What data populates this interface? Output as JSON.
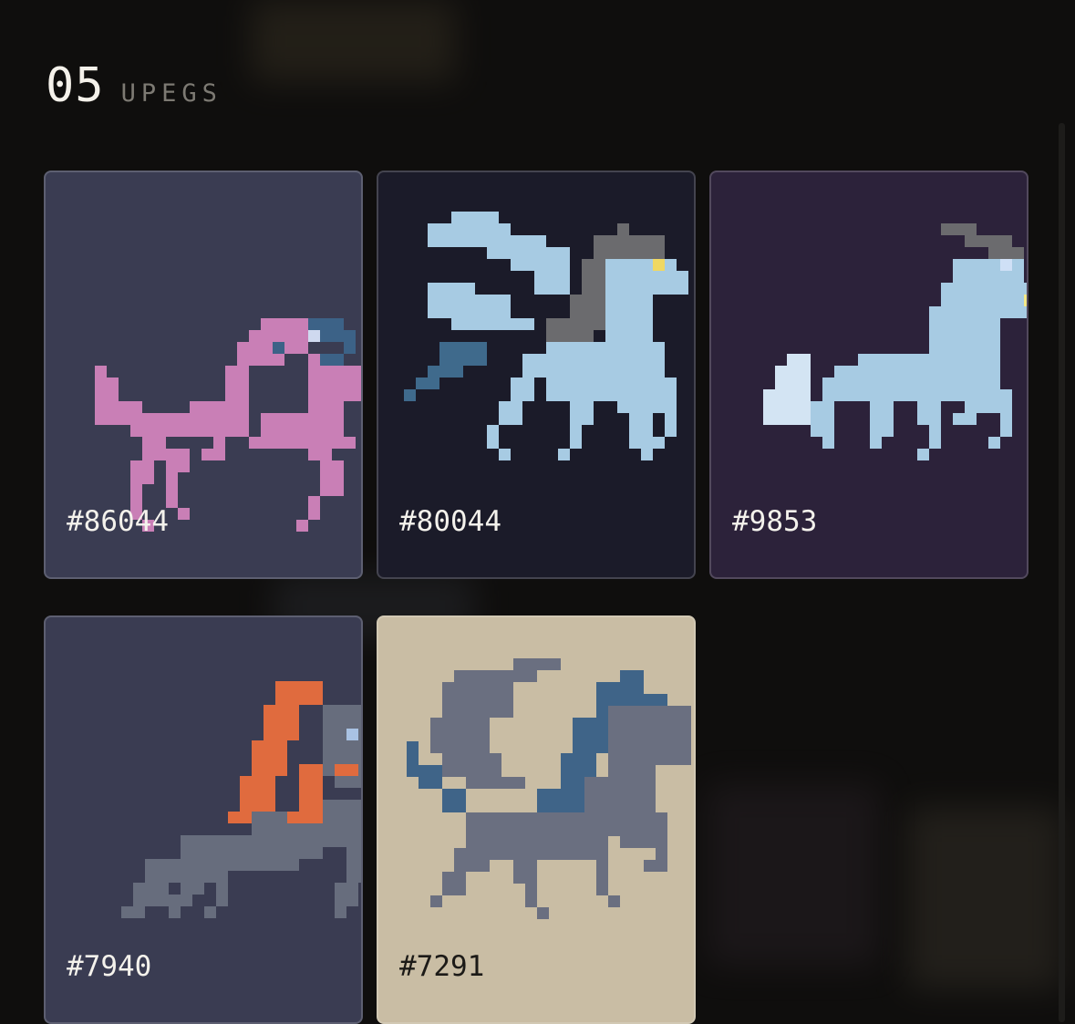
{
  "section": {
    "count": "05",
    "label": "UPEGS"
  },
  "cards": [
    {
      "id": "#86044",
      "bg": "#3a3c52",
      "text_color": "#f4f2ec",
      "icon": "horse-icon",
      "colors": {
        "body": "#c97fb6",
        "mane": "#c97fb6",
        "muzzle": "#3c6287",
        "eye": "#cfd9ef",
        "tail": "#c97fb6"
      }
    },
    {
      "id": "#80044",
      "bg": "#1b1b29",
      "text_color": "#f4f2ec",
      "icon": "pegasus-icon",
      "colors": {
        "body": "#a7cbe3",
        "wings": "#a7cbe3",
        "mane": "#6b6b6e",
        "eye": "#f0d862",
        "tail": "#3f6a8c"
      }
    },
    {
      "id": "#9853",
      "bg": "#2c223a",
      "text_color": "#f4f2ec",
      "icon": "unicorn-icon",
      "colors": {
        "body": "#a7cbe3",
        "horn": "#6b6b6e",
        "eye": "#cfe0f6",
        "tail": "#d3e4f3",
        "teeth": "#f3e887"
      }
    },
    {
      "id": "#7940",
      "bg": "#3a3c52",
      "text_color": "#f4f2ec",
      "icon": "horse-icon",
      "colors": {
        "body": "#676d7d",
        "mane": "#e06b3e",
        "muzzle": "#e06b3e",
        "eye": "#a9c2e3"
      }
    },
    {
      "id": "#7291",
      "bg": "#c9bda4",
      "text_color": "#1c1a17",
      "icon": "pegasus-icon",
      "colors": {
        "body": "#6a6f80",
        "wings": "#6a6f80",
        "mane": "#3f6488",
        "tail": "#3f6488"
      }
    }
  ]
}
